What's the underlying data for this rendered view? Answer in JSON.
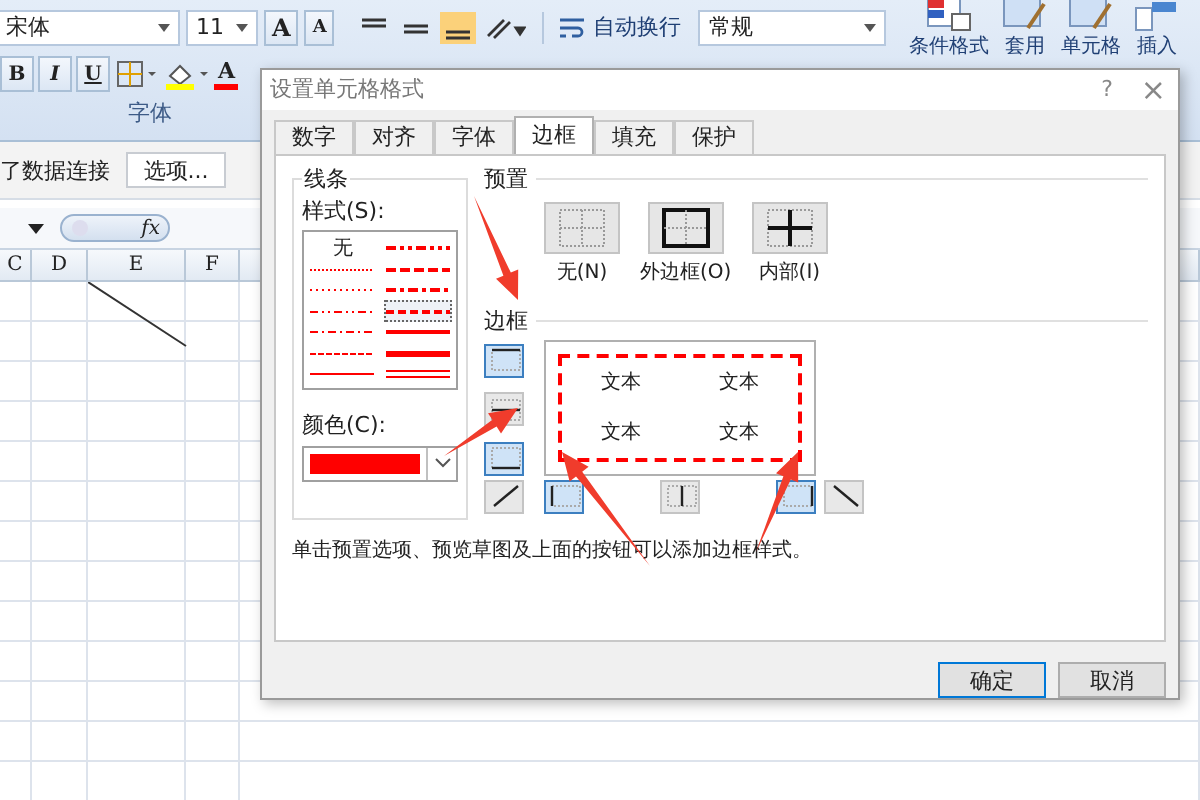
{
  "ribbon": {
    "font_name": "宋体",
    "font_size": "11",
    "grow_label": "A",
    "shrink_label": "A",
    "format_buttons": [
      {
        "label": "B",
        "kind": "bold"
      },
      {
        "label": "I",
        "kind": "italic"
      },
      {
        "label": "U",
        "kind": "underline"
      }
    ],
    "fill": {
      "color": "#ffff00"
    },
    "font_color": {
      "label": "A",
      "color": "#ff0000"
    },
    "wrap_text": "自动换行",
    "number_format": "常规",
    "font_group_label": "字体",
    "large_buttons": [
      {
        "label": "条件格式",
        "kind": "conditional"
      },
      {
        "label": "套用",
        "kind": "table"
      },
      {
        "label": "单元格",
        "kind": "style"
      },
      {
        "label": "插入",
        "kind": "insert"
      }
    ]
  },
  "message_bar": {
    "text": "了数据连接",
    "button": "选项..."
  },
  "formula_bar": {
    "fx": "fx"
  },
  "columns": [
    "C",
    "D",
    "E",
    "F"
  ],
  "dialog": {
    "title": "设置单元格格式",
    "help": "?",
    "close": "×",
    "tabs": [
      {
        "label": "数字",
        "selected": false
      },
      {
        "label": "对齐",
        "selected": false
      },
      {
        "label": "字体",
        "selected": false
      },
      {
        "label": "边框",
        "selected": true
      },
      {
        "label": "填充",
        "selected": false
      },
      {
        "label": "保护",
        "selected": false
      }
    ],
    "line_group": "线条",
    "style_label": "样式(S):",
    "styles": [
      {
        "kind": "none",
        "label": "无",
        "selected": false
      },
      {
        "kind": "hair",
        "selected": false
      },
      {
        "kind": "dotted",
        "selected": false
      },
      {
        "kind": "dashdotdot",
        "selected": false
      },
      {
        "kind": "dashdot",
        "selected": false
      },
      {
        "kind": "fine",
        "selected": false
      },
      {
        "kind": "thin",
        "selected": false
      },
      {
        "kind": "medium-dashdotdot",
        "selected": false
      },
      {
        "kind": "medium-dashed",
        "selected": false
      },
      {
        "kind": "medium-dashdot",
        "selected": false
      },
      {
        "kind": "dashed",
        "selected": true
      },
      {
        "kind": "medium",
        "selected": false
      },
      {
        "kind": "thick",
        "selected": false
      },
      {
        "kind": "double",
        "selected": false
      }
    ],
    "color_label": "颜色(C):",
    "color": "#ff0000",
    "preset_label": "预置",
    "presets": [
      {
        "kind": "none",
        "label": "无(N)"
      },
      {
        "kind": "outline",
        "label": "外边框(O)"
      },
      {
        "kind": "inside",
        "label": "内部(I)"
      }
    ],
    "border_label": "边框",
    "border_buttons": [
      {
        "kind": "top",
        "selected": true
      },
      {
        "kind": "middle",
        "selected": false
      },
      {
        "kind": "bottom",
        "selected": true
      },
      {
        "kind": "diag_up",
        "selected": false
      },
      {
        "kind": "left",
        "selected": true
      },
      {
        "kind": "center",
        "selected": false
      },
      {
        "kind": "right",
        "selected": true
      },
      {
        "kind": "diag_down",
        "selected": false
      }
    ],
    "preview_cells": [
      "文本",
      "文本",
      "文本",
      "文本"
    ],
    "hint": "单击预置选项、预览草图及上面的按钮可以添加边框样式。",
    "buttons": [
      {
        "label": "确定",
        "default": true
      },
      {
        "label": "取消",
        "default": false
      }
    ]
  }
}
